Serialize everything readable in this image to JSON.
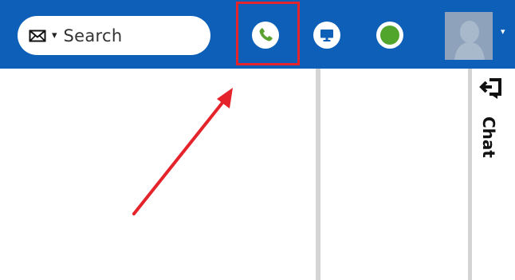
{
  "search": {
    "label": "Search",
    "icon": "mail-icon",
    "caret": "▾"
  },
  "toolbar": {
    "buttons": [
      {
        "name": "call-button",
        "icon": "phone-icon",
        "highlighted": true
      },
      {
        "name": "screen-share-button",
        "icon": "monitor-icon"
      },
      {
        "name": "status-button",
        "icon": "status-dot-icon",
        "status_color": "#51a52c"
      }
    ]
  },
  "profile": {
    "icon": "avatar-silhouette-icon",
    "caret": "▾"
  },
  "chat_rail": {
    "label": "Chat",
    "icon": "popout-arrow-icon"
  },
  "colors": {
    "topbar": "#0d5fb8",
    "highlight": "#e4232b",
    "phone_accent": "#5aa131",
    "status_online": "#51a52c"
  }
}
